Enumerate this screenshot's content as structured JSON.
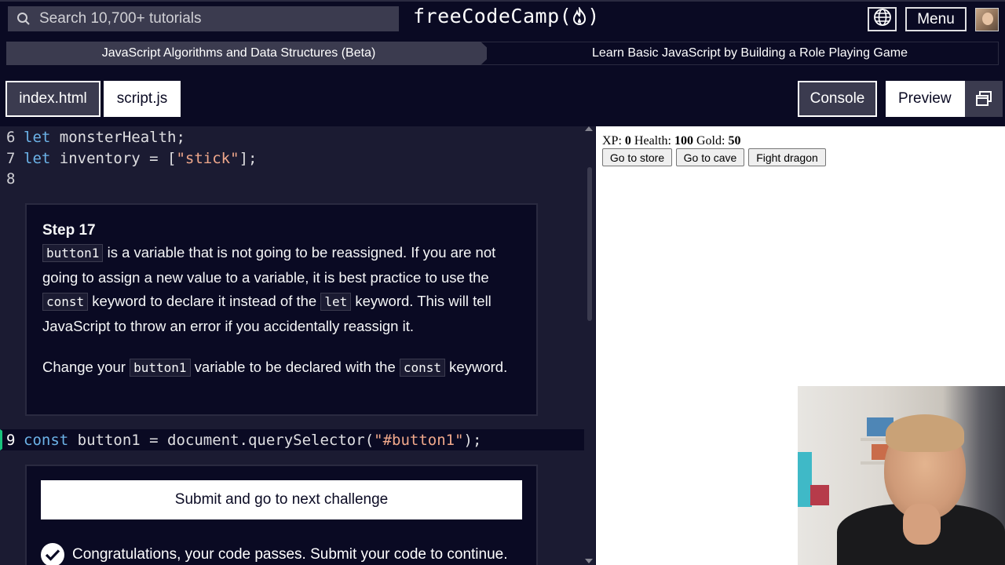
{
  "nav": {
    "search_placeholder": "Search 10,700+ tutorials",
    "logo_text": "freeCodeCamp",
    "logo_paren_open": "(",
    "logo_paren_close": ")",
    "menu_label": "Menu"
  },
  "breadcrumb": {
    "course": "JavaScript Algorithms and Data Structures (Beta)",
    "project": "Learn Basic JavaScript by Building a Role Playing Game"
  },
  "tabs": {
    "index": "index.html",
    "script": "script.js",
    "console": "Console",
    "preview": "Preview"
  },
  "editor": {
    "lines": [
      {
        "num": "6",
        "kw": "let",
        "rest": " monsterHealth;"
      },
      {
        "num": "7",
        "kw": "let",
        "rest_pre": " inventory = [",
        "str": "\"stick\"",
        "rest_post": "];"
      },
      {
        "num": "8"
      }
    ],
    "active_line": {
      "num": "9",
      "kw": "const",
      "rest_pre": " button1 = document.querySelector(",
      "str": "\"#button1\"",
      "rest_post": ");"
    }
  },
  "step": {
    "title": "Step 17",
    "p1": {
      "code1": "button1",
      "t1": " is a variable that is not going to be reassigned. If you are not going to assign a new value to a variable, it is best practice to use the ",
      "code2": "const",
      "t2": " keyword to declare it instead of the ",
      "code3": "let",
      "t3": " keyword. This will tell JavaScript to throw an error if you accidentally reassign it."
    },
    "p2": {
      "t1": "Change your ",
      "code1": "button1",
      "t2": " variable to be declared with the ",
      "code2": "const",
      "t3": " keyword."
    }
  },
  "submit": {
    "button_label": "Submit and go to next challenge",
    "pass_message": "Congratulations, your code passes. Submit your code to continue."
  },
  "preview": {
    "xp_label": "XP:",
    "xp_value": "0",
    "health_label": "Health:",
    "health_value": "100",
    "gold_label": "Gold:",
    "gold_value": "50",
    "buttons": [
      "Go to store",
      "Go to cave",
      "Fight dragon"
    ]
  },
  "colors": {
    "bg_dark": "#0a0a23",
    "editor_bg": "#1b1b32",
    "panel_gray": "#3b3b4f",
    "keyword": "#6cb3e8",
    "string": "#f0a88b",
    "active_line_marker": "#19c37d"
  },
  "icons": [
    "search-icon",
    "flame-icon",
    "globe-icon",
    "avatar",
    "preview-window-icon",
    "check-icon"
  ]
}
